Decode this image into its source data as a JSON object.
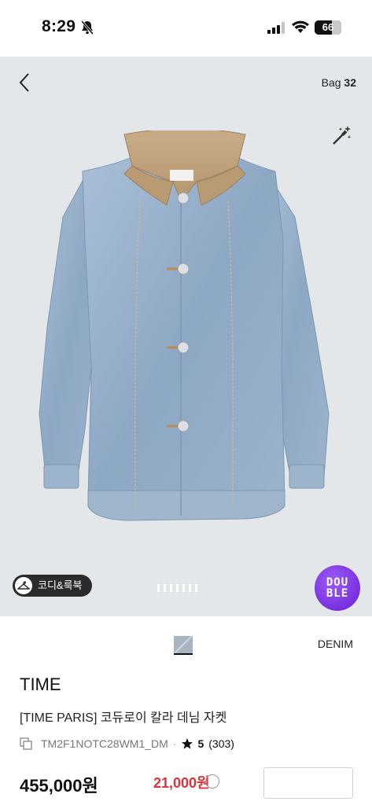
{
  "status_bar": {
    "time": "8:29",
    "battery": "66",
    "battery_level": 0.66,
    "icons": [
      "bell-slash-icon",
      "cellular-signal-icon",
      "wifi-icon",
      "battery-icon"
    ]
  },
  "header": {
    "back_icon": "chevron-left-icon",
    "bag_label": "Bag",
    "bag_count": "32",
    "magic_icon": "magic-wand-icon"
  },
  "gallery": {
    "coordi_label": "코디&룩북",
    "coordi_icon": "hanger-icon",
    "page_count": 7,
    "double_badge": [
      "DOU",
      "BLE"
    ]
  },
  "product": {
    "color_label": "DENIM",
    "brand": "TIME",
    "name": "[TIME PARIS] 코듀로이 칼라 데님 자켓",
    "code": "TM2F1NOTC28WM1_DM",
    "separator": "·",
    "rating": "5",
    "review_count": "(303)",
    "price": "455,000원",
    "discount": "21,000원"
  },
  "colors": {
    "hero_bg": "#e4e7ea",
    "denim": "#8fa8c4",
    "collar": "#c0a27b",
    "badge": "#7a32e8",
    "discount": "#e0323a"
  }
}
